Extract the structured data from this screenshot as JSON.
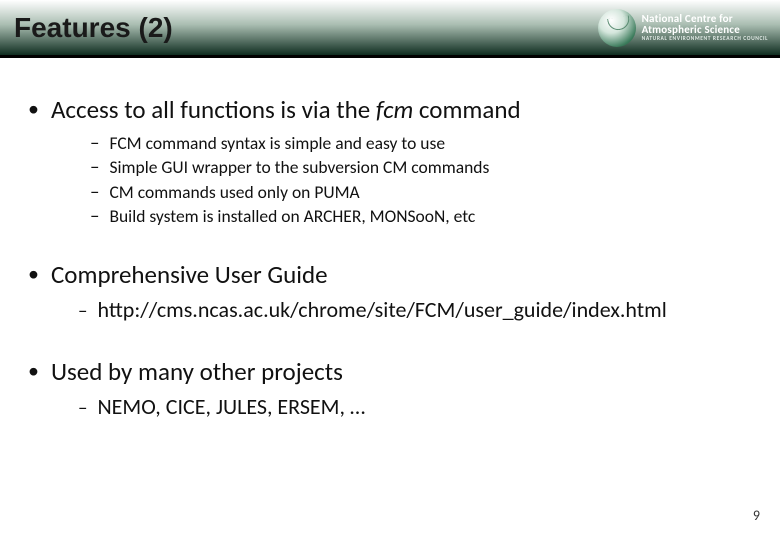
{
  "header": {
    "title": "Features (2)",
    "logo": {
      "line1": "National Centre for",
      "line2": "Atmospheric Science",
      "sub": "NATURAL ENVIRONMENT RESEARCH COUNCIL"
    }
  },
  "topics": [
    {
      "text_pre": "Access to all functions is via the ",
      "text_em": "fcm",
      "text_post": " command",
      "sub_style": "small",
      "subs": [
        "FCM command syntax is simple and easy to use",
        "Simple GUI wrapper to the subversion CM commands",
        "CM commands used only on PUMA",
        "Build system is installed on ARCHER, MONSooN, etc"
      ]
    },
    {
      "text_pre": "Comprehensive User Guide",
      "text_em": "",
      "text_post": "",
      "sub_style": "big",
      "subs": [
        "http://cms.ncas.ac.uk/chrome/site/FCM/user_guide/index.html"
      ]
    },
    {
      "text_pre": "Used by many other projects",
      "text_em": "",
      "text_post": "",
      "sub_style": "big",
      "subs": [
        "NEMO, CICE, JULES, ERSEM, …"
      ]
    }
  ],
  "page_number": "9",
  "glyphs": {
    "bullet": "•",
    "dash": "–"
  }
}
